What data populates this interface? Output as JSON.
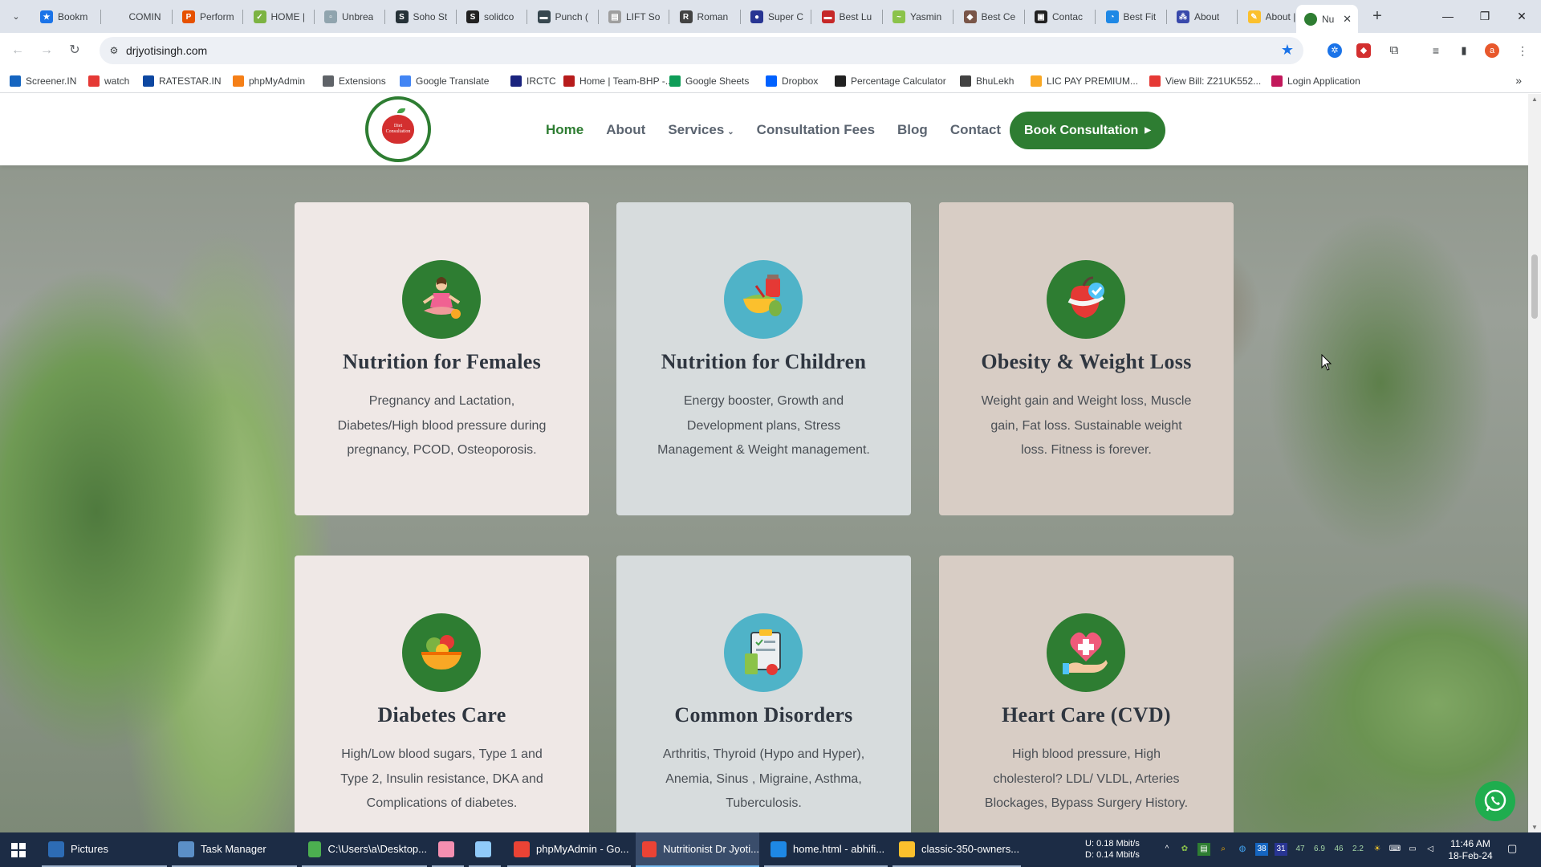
{
  "browser": {
    "tabs": [
      {
        "title": "Bookm",
        "color": "#1a73e8",
        "glyph": "★"
      },
      {
        "title": "COMIN",
        "color": "#dee3eb",
        "glyph": ""
      },
      {
        "title": "Perform",
        "color": "#e65100",
        "glyph": "P"
      },
      {
        "title": "HOME |",
        "color": "#7cb342",
        "glyph": "✓"
      },
      {
        "title": "Unbrea",
        "color": "#90a4ae",
        "glyph": "▫"
      },
      {
        "title": "Soho St",
        "color": "#263238",
        "glyph": "S"
      },
      {
        "title": "solidco",
        "color": "#212121",
        "glyph": "S"
      },
      {
        "title": "Punch (",
        "color": "#37474f",
        "glyph": "▬"
      },
      {
        "title": "LIFT So",
        "color": "#9e9e9e",
        "glyph": "▤"
      },
      {
        "title": "Roman",
        "color": "#424242",
        "glyph": "R"
      },
      {
        "title": "Super C",
        "color": "#283593",
        "glyph": "●"
      },
      {
        "title": "Best Lu",
        "color": "#c62828",
        "glyph": "▬"
      },
      {
        "title": "Yasmin",
        "color": "#8bc34a",
        "glyph": "~"
      },
      {
        "title": "Best Ce",
        "color": "#795548",
        "glyph": "◆"
      },
      {
        "title": "Contac",
        "color": "#212121",
        "glyph": "▣"
      },
      {
        "title": "Best Fit",
        "color": "#1e88e5",
        "glyph": "◔"
      },
      {
        "title": "About",
        "color": "#3949ab",
        "glyph": "⁂"
      },
      {
        "title": "About |",
        "color": "#fbc02d",
        "glyph": "✎"
      }
    ],
    "active_tab": {
      "title": "Nu",
      "color": "#2e7d32"
    },
    "close_glyph": "✕",
    "new_tab_glyph": "+",
    "window_controls": {
      "minimize": "—",
      "restore": "❐",
      "close": "✕"
    },
    "nav": {
      "back": "←",
      "forward": "→",
      "reload": "↻"
    },
    "url": "drjyotisingh.com",
    "bookmarks": [
      {
        "label": "Screener.IN",
        "color": "#1565c0"
      },
      {
        "label": "watch",
        "color": "#e53935"
      },
      {
        "label": "RATESTAR.IN",
        "color": "#0d47a1"
      },
      {
        "label": "phpMyAdmin",
        "color": "#f57f17"
      },
      {
        "label": "Extensions",
        "color": "#5f6368"
      },
      {
        "label": "Google Translate",
        "color": "#4285f4"
      },
      {
        "label": "IRCTC",
        "color": "#1a237e"
      },
      {
        "label": "Home | Team-BHP -...",
        "color": "#b71c1c"
      },
      {
        "label": "Google Sheets",
        "color": "#0f9d58"
      },
      {
        "label": "Dropbox",
        "color": "#0061ff"
      },
      {
        "label": "Percentage Calculator",
        "color": "#212121"
      },
      {
        "label": "BhuLekh",
        "color": "#424242"
      },
      {
        "label": "LIC PAY PREMIUM...",
        "color": "#f9a825"
      },
      {
        "label": "View Bill: Z21UK552...",
        "color": "#e53935"
      },
      {
        "label": "Login Application",
        "color": "#c2185b"
      }
    ],
    "bookmarks_more": "»",
    "profile_initial": "a"
  },
  "site": {
    "logo_text": "Diet Consultation",
    "nav": [
      {
        "label": "Home",
        "active": true
      },
      {
        "label": "About",
        "active": false
      },
      {
        "label": "Services",
        "active": false,
        "caret": "⌄"
      },
      {
        "label": "Consultation Fees",
        "active": false
      },
      {
        "label": "Blog",
        "active": false
      },
      {
        "label": "Contact",
        "active": false
      }
    ],
    "cta": {
      "label": "Book Consultation",
      "arrow": "▶"
    },
    "cards": [
      {
        "title": "Nutrition for Females",
        "text": "Pregnancy and Lactation, Diabetes/High blood pressure during pregnancy, PCOD, Osteoporosis.",
        "icon": "meditating-woman-icon",
        "icon_color": "#2e7d32"
      },
      {
        "title": "Nutrition for Children",
        "text": "Energy booster, Growth and Development plans, Stress Management & Weight management.",
        "icon": "food-bowl-icon",
        "icon_color": "#4fb3c8"
      },
      {
        "title": "Obesity & Weight Loss",
        "text": "Weight gain and Weight loss, Muscle gain, Fat loss. Sustainable weight loss. Fitness is forever.",
        "icon": "apple-tape-icon",
        "icon_color": "#2e7d32"
      },
      {
        "title": "Diabetes Care",
        "text": "High/Low blood sugars, Type 1 and Type 2, Insulin resistance, DKA and Complications of diabetes.",
        "icon": "salad-bowl-icon",
        "icon_color": "#2e7d32"
      },
      {
        "title": "Common Disorders",
        "text": "Arthritis, Thyroid (Hypo and Hyper), Anemia, Sinus , Migraine, Asthma, Tuberculosis.",
        "icon": "diet-clipboard-icon",
        "icon_color": "#4fb3c8"
      },
      {
        "title": "Heart Care (CVD)",
        "text": "High blood pressure, High cholesterol? LDL/ VLDL, Arteries Blockages, Bypass Surgery History.",
        "icon": "heart-hand-icon",
        "icon_color": "#2e7d32"
      }
    ]
  },
  "taskbar": {
    "items": [
      {
        "label": "Pictures",
        "color": "#2d6cb5"
      },
      {
        "label": "Task Manager",
        "color": "#5b8fc7"
      },
      {
        "label": "C:\\Users\\a\\Desktop...",
        "color": "#4caf50"
      },
      {
        "label": "",
        "color": "#f48fb1"
      },
      {
        "label": "",
        "color": "#90caf9"
      },
      {
        "label": "phpMyAdmin - Go...",
        "color": "#ea4335"
      },
      {
        "label": "Nutritionist Dr Jyoti...",
        "color": "#ea4335"
      },
      {
        "label": "home.html - abhifi...",
        "color": "#1e88e5"
      },
      {
        "label": "classic-350-owners...",
        "color": "#fbc02d"
      }
    ],
    "net_up_label": "U:",
    "net_up": "0.18 Mbit/s",
    "net_down_label": "D:",
    "net_down": "0.14 Mbit/s",
    "tray_numbers": [
      "47",
      "6.9",
      "46",
      "2.2"
    ],
    "time": "11:46 AM",
    "date": "18-Feb-24"
  }
}
